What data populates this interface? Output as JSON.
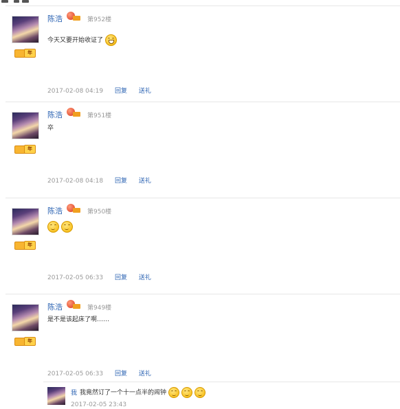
{
  "posts": [
    {
      "user": "陈浩",
      "floor": "第952楼",
      "content": "今天又要开始收证了",
      "emojis": [
        "grin-emoji"
      ],
      "time": "2017-02-08 04:19",
      "reply": "回复",
      "gift": "送礼",
      "badge": "年"
    },
    {
      "user": "陈浩",
      "floor": "第951楼",
      "content": "卒",
      "emojis": [],
      "time": "2017-02-08 04:18",
      "reply": "回复",
      "gift": "送礼",
      "badge": "年"
    },
    {
      "user": "陈浩",
      "floor": "第950楼",
      "content": "",
      "emojis": [
        "pout-emoji",
        "pout-emoji"
      ],
      "time": "2017-02-05 06:33",
      "reply": "回复",
      "gift": "送礼",
      "badge": "年"
    },
    {
      "user": "陈浩",
      "floor": "第949楼",
      "content": "是不是该起床了啊……",
      "emojis": [],
      "time": "2017-02-05 06:33",
      "reply": "回复",
      "gift": "送礼",
      "badge": "年"
    }
  ],
  "subreply": {
    "user": "我",
    "content": "我竟然订了一个十一点半的闹钟",
    "emojis": [
      "pout-emoji",
      "pout-emoji",
      "pout-emoji"
    ],
    "time": "2017-02-05 23:43"
  },
  "colors": {
    "link": "#2d64b3",
    "muted": "#999999",
    "separator": "#e6e6e6"
  }
}
